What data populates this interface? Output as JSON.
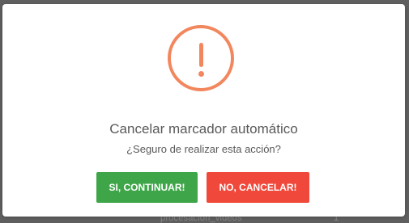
{
  "background": {
    "peek_text": "procesación_videos",
    "peek_suffix": "1"
  },
  "dialog": {
    "icon": "exclamation-circle-icon",
    "icon_color": "#f2875e",
    "title": "Cancelar marcador automático",
    "message": "¿Seguro de realizar esta acción?",
    "confirm_label": "SI, CONTINUAR!",
    "confirm_color": "#3ea649",
    "cancel_label": "NO, CANCELAR!",
    "cancel_color": "#f0483a"
  }
}
